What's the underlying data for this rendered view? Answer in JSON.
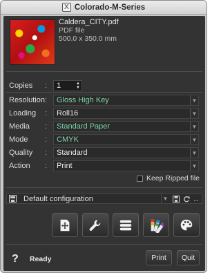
{
  "window": {
    "title": "Colorado-M-Series"
  },
  "file": {
    "name": "Caldera_CITY.pdf",
    "type": "PDF file",
    "size": "500.0 x 350.0 mm"
  },
  "settings": {
    "copies": {
      "label": "Copies",
      "value": "1"
    },
    "rows": [
      {
        "label": "Resolution",
        "value": "Gloss High Key",
        "color": "#7fd3a8"
      },
      {
        "label": "Loading",
        "value": "Roll16",
        "color": "#e8e8e8"
      },
      {
        "label": "Media",
        "value": "Standard Paper",
        "color": "#7fd3a8"
      },
      {
        "label": "Mode",
        "value": "CMYK",
        "color": "#7fd3a8"
      },
      {
        "label": "Quality",
        "value": "Standard",
        "color": "#e8e8e8"
      },
      {
        "label": "Action",
        "value": "Print",
        "color": "#e8e8e8"
      }
    ],
    "colon": ":"
  },
  "keep_ripped": {
    "label": "Keep Ripped file",
    "checked": false
  },
  "config": {
    "name": "Default configuration",
    "more": "..."
  },
  "toolbar": {
    "icons": [
      "position-icon",
      "wrench-icon",
      "menu-icon",
      "swatches-icon",
      "palette-icon"
    ]
  },
  "footer": {
    "help": "?",
    "status": "Ready",
    "print_label": "Print",
    "quit_label": "Quit"
  }
}
